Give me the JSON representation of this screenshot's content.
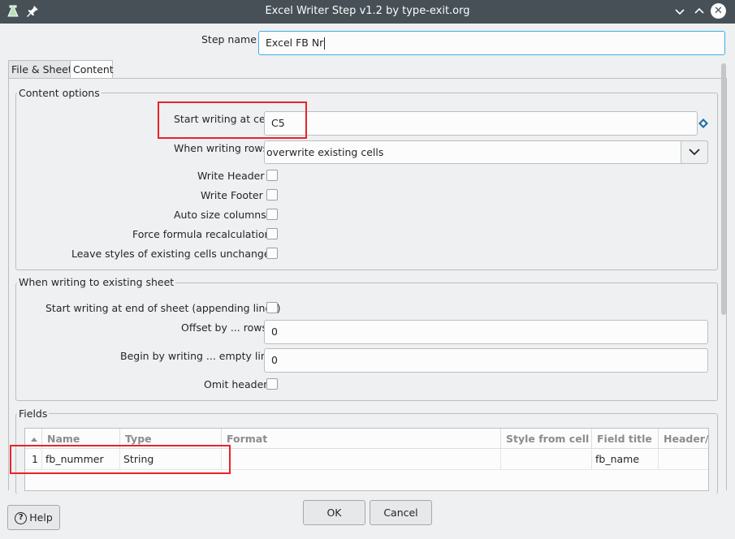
{
  "window": {
    "title": "Excel Writer Step v1.2 by type-exit.org",
    "app_icon": "app-icon",
    "pin_icon": "pin-icon",
    "minimize_glyph": "⌄",
    "maximize_glyph": "⌃",
    "close_glyph": "✕"
  },
  "step_name": {
    "label": "Step name",
    "value": "Excel FB Nr"
  },
  "tabs": [
    {
      "label": "File & Sheet",
      "active": false
    },
    {
      "label": "Content",
      "active": true
    }
  ],
  "content_options": {
    "title": "Content options",
    "start_cell": {
      "label": "Start writing at cell",
      "value": "C5",
      "var_icon": "variable-diamond-icon"
    },
    "when_writing_rows": {
      "label": "When writing rows",
      "value": "overwrite existing cells"
    },
    "checkboxes": [
      {
        "label": "Write Header",
        "checked": false
      },
      {
        "label": "Write Footer",
        "checked": false
      },
      {
        "label": "Auto size columns",
        "checked": false
      },
      {
        "label": "Force formula recalculation",
        "checked": false
      },
      {
        "label": "Leave styles of existing cells unchanged",
        "checked": false
      }
    ]
  },
  "existing_sheet": {
    "title": "When writing to existing sheet",
    "append": {
      "label": "Start writing at end of sheet (appending lines)",
      "checked": false
    },
    "offset": {
      "label": "Offset by ... rows",
      "value": "0"
    },
    "empty_lines": {
      "label": "Begin by writing ... empty lines",
      "value": "0"
    },
    "omit_header": {
      "label": "Omit header",
      "checked": false
    }
  },
  "fields": {
    "title": "Fields",
    "columns": [
      "",
      "Name",
      "Type",
      "Format",
      "Style from cell",
      "Field title",
      "Header/F"
    ],
    "rows": [
      {
        "num": "1",
        "name": "fb_nummer",
        "type": "String",
        "format": "",
        "style": "",
        "field_title": "fb_name",
        "header": ""
      }
    ]
  },
  "buttons": {
    "help": "Help",
    "ok": "OK",
    "cancel": "Cancel"
  },
  "colors": {
    "titlebar": "#475057",
    "highlight": "#e8232c",
    "focus": "#3daee9"
  }
}
